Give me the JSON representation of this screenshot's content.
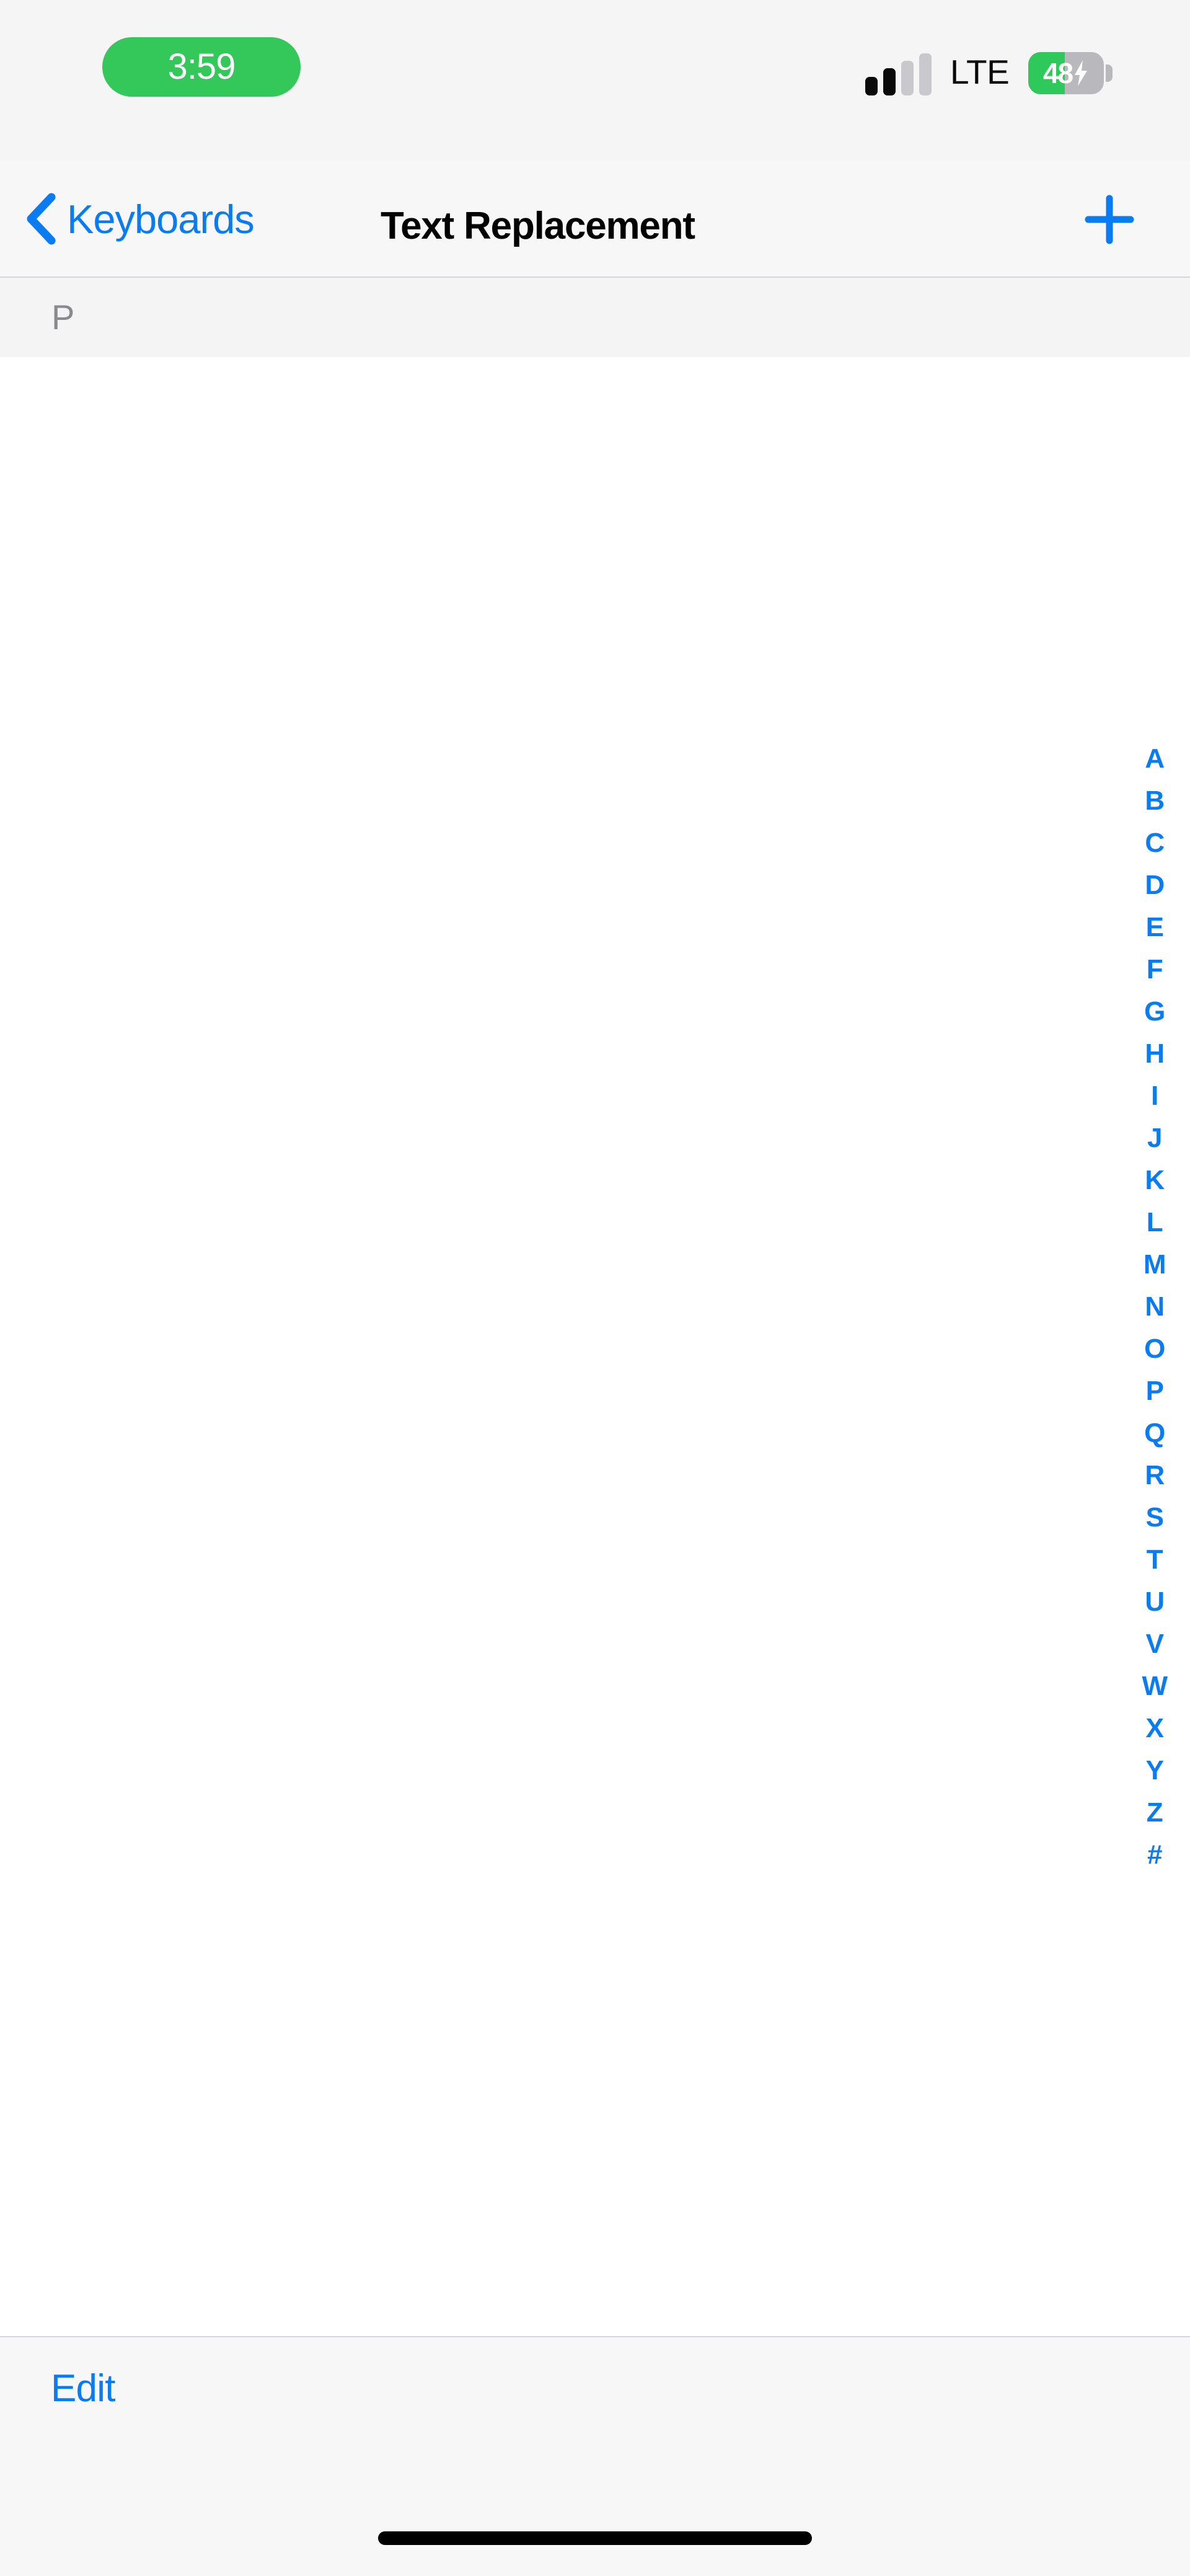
{
  "status_bar": {
    "time": "3:59",
    "time_pill_color": "#34C759",
    "carrier": "LTE",
    "signal_bars_total": 4,
    "signal_bars_active": 2,
    "battery_percent": "48",
    "battery_charging": true,
    "battery_fill_color": "#2FC85A"
  },
  "nav_bar": {
    "back_label": "Keyboards",
    "title": "Text Replacement",
    "add_label": "+",
    "tint_color": "#0A7CF3"
  },
  "section_header": {
    "letter": "P"
  },
  "list": {
    "rows": []
  },
  "section_index": {
    "letters": [
      "A",
      "B",
      "C",
      "D",
      "E",
      "F",
      "G",
      "H",
      "I",
      "J",
      "K",
      "L",
      "M",
      "N",
      "O",
      "P",
      "Q",
      "R",
      "S",
      "T",
      "U",
      "V",
      "W",
      "X",
      "Y",
      "Z",
      "#"
    ],
    "color": "#0A7CF3"
  },
  "toolbar": {
    "edit_label": "Edit"
  }
}
